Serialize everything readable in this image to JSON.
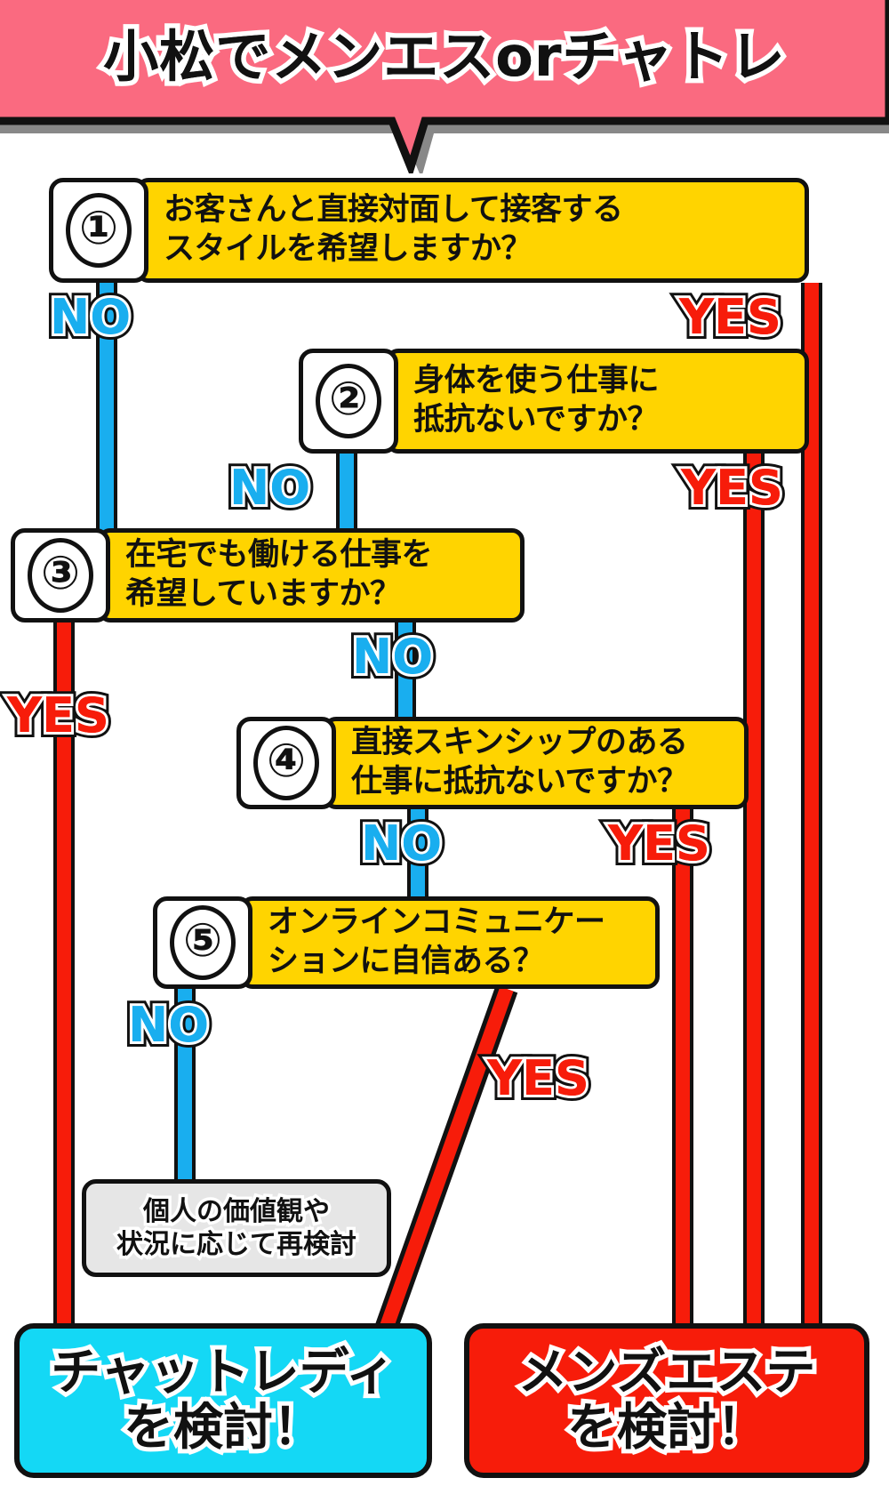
{
  "header": {
    "title": "小松でメンエスorチャトレ",
    "bubble_color": "#FA6A80"
  },
  "colors": {
    "yellow": "#FFD400",
    "no_blue": "#19AEEF",
    "yes_red": "#F71C0A",
    "chat_cyan": "#14D8F5",
    "este_red": "#F71C0A",
    "note_gray": "#E6E6E6",
    "outline": "#111111"
  },
  "questions": [
    {
      "number": "①",
      "line1": "お客さんと直接対面して接客する",
      "line2": "スタイルを希望しますか？",
      "no_label": "NO",
      "yes_label": "YES"
    },
    {
      "number": "②",
      "line1": "身体を使う仕事に",
      "line2": "抵抗ないですか？",
      "no_label": "NO",
      "yes_label": "YES"
    },
    {
      "number": "③",
      "line1": "在宅でも働ける仕事を",
      "line2": "希望していますか？",
      "no_label": "NO",
      "yes_label": "YES"
    },
    {
      "number": "④",
      "line1": "直接スキンシップのある",
      "line2": "仕事に抵抗ないですか？",
      "no_label": "NO",
      "yes_label": "YES"
    },
    {
      "number": "⑤",
      "line1": "オンラインコミュニケー",
      "line2": "ションに自信ある？",
      "no_label": "NO",
      "yes_label": "YES"
    }
  ],
  "note": {
    "line1": "個人の価値観や",
    "line2": "状況に応じて再検討"
  },
  "results": {
    "chat": {
      "line1": "チャットレディ",
      "line2": "を検討！"
    },
    "este": {
      "line1": "メンズエステ",
      "line2": "を検討！"
    }
  }
}
